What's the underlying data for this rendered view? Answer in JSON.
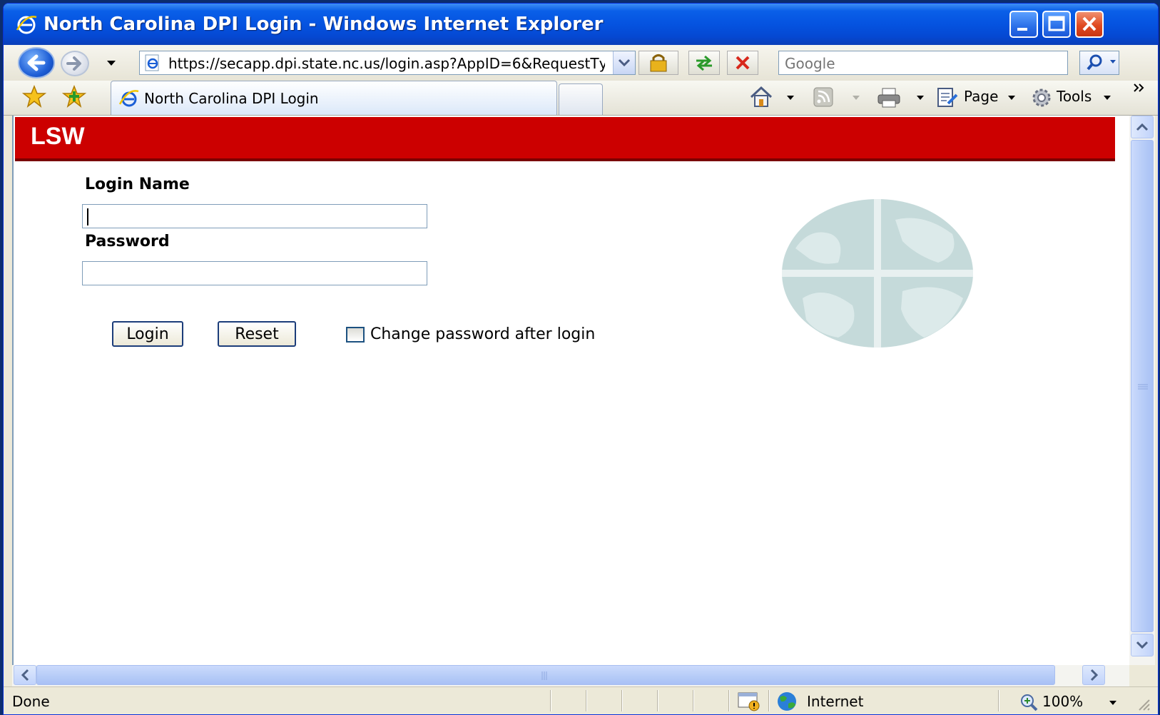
{
  "window": {
    "title": "North Carolina DPI Login - Windows Internet Explorer"
  },
  "navigation": {
    "address": "https://secapp.dpi.state.nc.us/login.asp?AppID=6&RequestTу",
    "search_placeholder": "Google"
  },
  "tabs": [
    {
      "label": "North Carolina DPI Login"
    }
  ],
  "commands": {
    "page_label": "Page",
    "tools_label": "Tools"
  },
  "page": {
    "banner_title": "LSW",
    "login_name_label": "Login Name",
    "login_name_value": "",
    "password_label": "Password",
    "password_value": "",
    "login_button": "Login",
    "reset_button": "Reset",
    "change_password_label": "Change password after login",
    "change_password_checked": false
  },
  "status": {
    "text": "Done",
    "zone": "Internet",
    "zoom": "100%"
  },
  "colors": {
    "banner": "#cc0000",
    "titlebar": "#0553e0"
  },
  "icons": [
    "ie-icon",
    "back-arrow-icon",
    "forward-arrow-icon",
    "lock-icon",
    "refresh-icon",
    "stop-icon",
    "search-icon",
    "favorites-star-icon",
    "add-favorites-icon",
    "home-icon",
    "feeds-icon",
    "print-icon",
    "page-icon",
    "tools-gear-icon",
    "globe-icon",
    "zoom-icon"
  ]
}
